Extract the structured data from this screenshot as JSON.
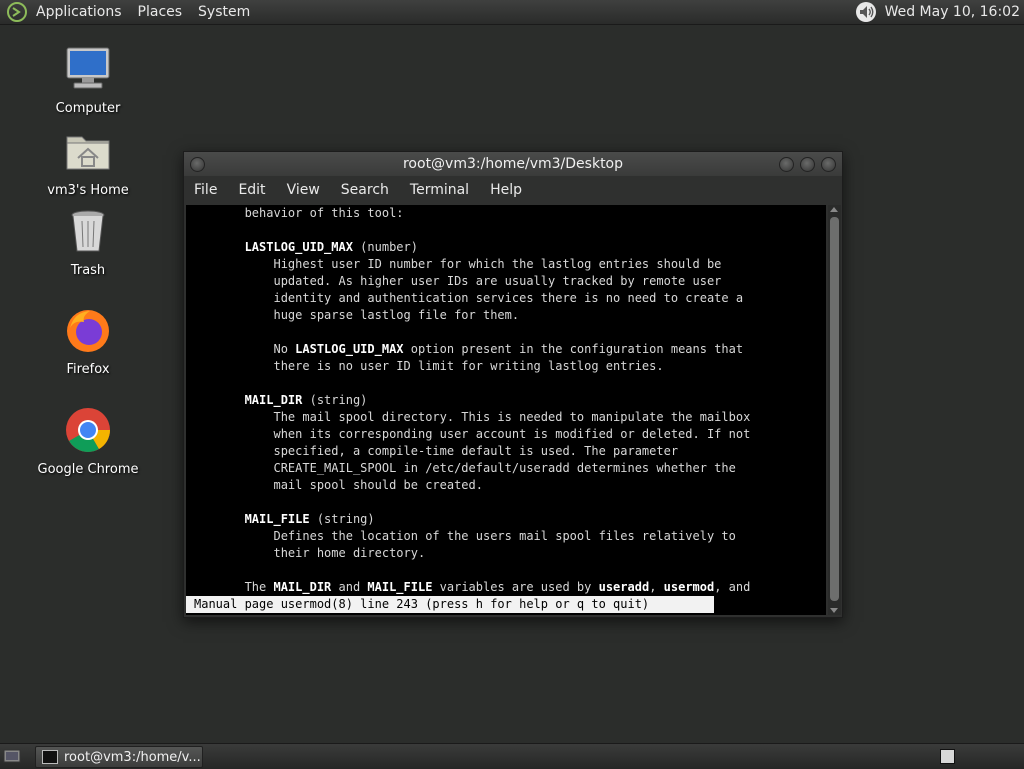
{
  "top_panel": {
    "menus": [
      "Applications",
      "Places",
      "System"
    ],
    "clock": "Wed May 10, 16:02"
  },
  "desktop": {
    "icons": [
      {
        "label": "Computer",
        "icon": "computer-icon"
      },
      {
        "label": "vm3's Home",
        "icon": "home-folder-icon"
      },
      {
        "label": "Trash",
        "icon": "trash-icon"
      },
      {
        "label": "Firefox",
        "icon": "firefox-icon"
      },
      {
        "label": "Google Chrome",
        "icon": "chrome-icon"
      }
    ]
  },
  "terminal": {
    "title": "root@vm3:/home/vm3/Desktop",
    "menus": [
      "File",
      "Edit",
      "View",
      "Search",
      "Terminal",
      "Help"
    ],
    "lines": [
      [
        {
          "t": "       behavior of this tool:"
        }
      ],
      [
        {
          "t": ""
        }
      ],
      [
        {
          "t": "       "
        },
        {
          "t": "LASTLOG_UID_MAX",
          "b": true
        },
        {
          "t": " (number)"
        }
      ],
      [
        {
          "t": "           Highest user ID number for which the lastlog entries should be"
        }
      ],
      [
        {
          "t": "           updated. As higher user IDs are usually tracked by remote user"
        }
      ],
      [
        {
          "t": "           identity and authentication services there is no need to create a"
        }
      ],
      [
        {
          "t": "           huge sparse lastlog file for them."
        }
      ],
      [
        {
          "t": ""
        }
      ],
      [
        {
          "t": "           No "
        },
        {
          "t": "LASTLOG_UID_MAX",
          "b": true
        },
        {
          "t": " option present in the configuration means that"
        }
      ],
      [
        {
          "t": "           there is no user ID limit for writing lastlog entries."
        }
      ],
      [
        {
          "t": ""
        }
      ],
      [
        {
          "t": "       "
        },
        {
          "t": "MAIL_DIR",
          "b": true
        },
        {
          "t": " (string)"
        }
      ],
      [
        {
          "t": "           The mail spool directory. This is needed to manipulate the mailbox"
        }
      ],
      [
        {
          "t": "           when its corresponding user account is modified or deleted. If not"
        }
      ],
      [
        {
          "t": "           specified, a compile-time default is used. The parameter"
        }
      ],
      [
        {
          "t": "           CREATE_MAIL_SPOOL in /etc/default/useradd determines whether the"
        }
      ],
      [
        {
          "t": "           mail spool should be created."
        }
      ],
      [
        {
          "t": ""
        }
      ],
      [
        {
          "t": "       "
        },
        {
          "t": "MAIL_FILE",
          "b": true
        },
        {
          "t": " (string)"
        }
      ],
      [
        {
          "t": "           Defines the location of the users mail spool files relatively to"
        }
      ],
      [
        {
          "t": "           their home directory."
        }
      ],
      [
        {
          "t": ""
        }
      ],
      [
        {
          "t": "       The "
        },
        {
          "t": "MAIL_DIR",
          "b": true
        },
        {
          "t": " and "
        },
        {
          "t": "MAIL_FILE",
          "b": true
        },
        {
          "t": " variables are used by "
        },
        {
          "t": "useradd",
          "b": true
        },
        {
          "t": ", "
        },
        {
          "t": "usermod",
          "b": true
        },
        {
          "t": ", and"
        }
      ]
    ],
    "status": "Manual page usermod(8) line 243 (press h for help or q to quit)"
  },
  "bottom_panel": {
    "task_label": "root@vm3:/home/v..."
  }
}
